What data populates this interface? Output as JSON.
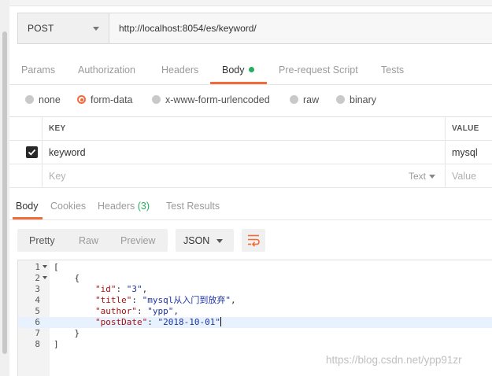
{
  "request": {
    "method": "POST",
    "url": "http://localhost:8054/es/keyword/"
  },
  "request_tabs": [
    {
      "label": "Params"
    },
    {
      "label": "Authorization"
    },
    {
      "label": "Headers"
    },
    {
      "label": "Body",
      "active": true
    },
    {
      "label": "Pre-request Script"
    },
    {
      "label": "Tests"
    }
  ],
  "body_types": [
    {
      "label": "none"
    },
    {
      "label": "form-data",
      "selected": true
    },
    {
      "label": "x-www-form-urlencoded"
    },
    {
      "label": "raw"
    },
    {
      "label": "binary"
    }
  ],
  "kv_table": {
    "key_header": "KEY",
    "value_header": "VALUE",
    "rows": [
      {
        "checked": true,
        "key": "keyword",
        "value": "mysql"
      }
    ],
    "new_row": {
      "key_placeholder": "Key",
      "type_label": "Text",
      "value_placeholder": "Value"
    }
  },
  "response_tabs": [
    {
      "label": "Body",
      "active": true
    },
    {
      "label": "Cookies"
    },
    {
      "label": "Headers",
      "count": "(3)"
    },
    {
      "label": "Test Results"
    }
  ],
  "format_buttons": [
    {
      "label": "Pretty",
      "active": true
    },
    {
      "label": "Raw"
    },
    {
      "label": "Preview"
    }
  ],
  "language_select": {
    "value": "JSON"
  },
  "wrap_icon": "wrap-lines-icon",
  "response_body": [
    {
      "n": "1",
      "fold": true,
      "text": "["
    },
    {
      "n": "2",
      "fold": true,
      "text": "    {"
    },
    {
      "n": "3",
      "key": "\"id\"",
      "value": "\"3\"",
      "indent": "        ",
      "comma": ","
    },
    {
      "n": "4",
      "key": "\"title\"",
      "value": "\"mysql从入门到放弃\"",
      "indent": "        ",
      "comma": ","
    },
    {
      "n": "5",
      "key": "\"author\"",
      "value": "\"ypp\"",
      "indent": "        ",
      "comma": ","
    },
    {
      "n": "6",
      "key": "\"postDate\"",
      "value": "\"2018-10-01\"",
      "indent": "        ",
      "comma": "",
      "highlight": true
    },
    {
      "n": "7",
      "text": "    }"
    },
    {
      "n": "8",
      "text": "]"
    }
  ],
  "watermark": "https://blog.csdn.net/ypp91zr",
  "colors": {
    "accent": "#f26b3a",
    "success": "#27ae60",
    "json_key": "#a11111",
    "json_string": "#1d33a6"
  }
}
